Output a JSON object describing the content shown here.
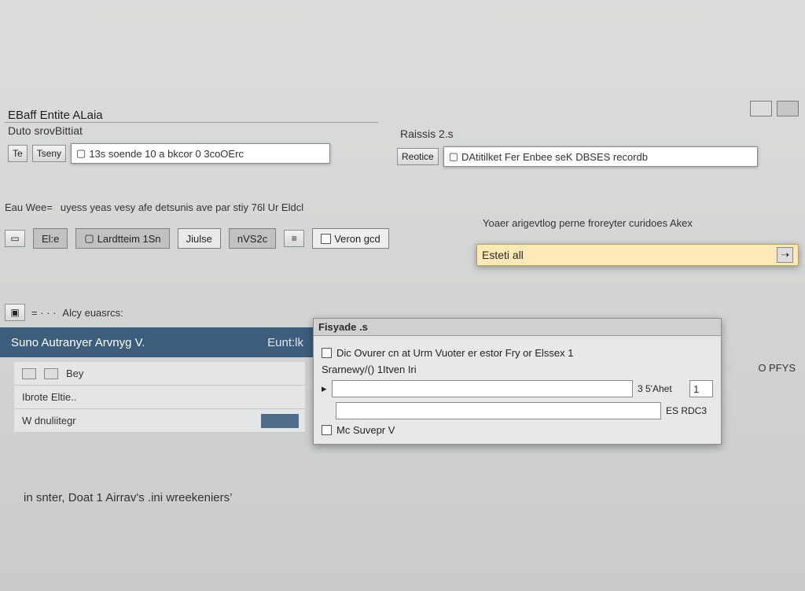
{
  "window": {
    "title": "EBaff Entite ALaia",
    "subtitle": "Duto srovBittiat",
    "btn_tle": "Te",
    "btn_tseny": "Tseny",
    "field1": "13s soende 10 a bkcor 0 3coOErc",
    "col_title": "Raissis 2.s",
    "btn_resotice": "Reotice",
    "field2": "DAtitilket Fer Enbee seK DBSES recordb",
    "desc_label": "Eau Wee=",
    "desc_text": "uyess yeas vesy afe detsunis ave par stiy 76l Ur Eldcl",
    "hint_right": "Yoaer arigevtlog perne froreyter curidoes Akex"
  },
  "toolbar": {
    "btn_a": "El:e",
    "btn_b": "Lardtteim 1Sn",
    "btn_c": "Jiulse",
    "btn_d": "nVS2c",
    "btn_e": "Veron gcd"
  },
  "search": {
    "value": "Esteti all"
  },
  "section": {
    "crumbs": "Alcy euasrcs:",
    "title": "Suno Autranyer Arvnyg V.",
    "col2": "Eunt:lk"
  },
  "list": {
    "r1": "Bey",
    "r2": "Ibrote Eltie..",
    "r3": "W dnuliitegr"
  },
  "panel": {
    "title": "Fisyade .s",
    "line1": "Dic Ovurer cn at Urm Vuoter er estor Fry or Elssex   1",
    "line2": "Srarnewy/()  1Itven Iri",
    "v1": "3 5'Ahet",
    "n1": "1",
    "v2": "ES RDC3",
    "save": "Mc Suvepr V"
  },
  "footer": "in snter, Doat 1 Airrav's .ini   wreekeniers’",
  "right_badge": "O PFYS"
}
